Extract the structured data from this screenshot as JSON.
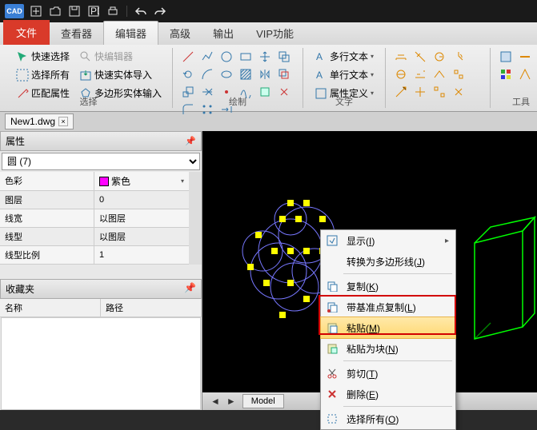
{
  "app": {
    "logo": "CAD"
  },
  "menu": {
    "file": "文件",
    "view": "查看器",
    "editor": "编辑器",
    "advanced": "高级",
    "output": "输出",
    "vip": "VIP功能"
  },
  "ribbon": {
    "select": {
      "quick_select": "快速选择",
      "quick_edit": "快编辑器",
      "select_all": "选择所有",
      "import_solid": "快速实体导入",
      "match_prop": "匹配属性",
      "polygon_input": "多边形实体输入",
      "label": "选择"
    },
    "draw": {
      "label": "绘制"
    },
    "text": {
      "mtext": "多行文本",
      "stext": "单行文本",
      "propdef": "属性定义",
      "label": "文字"
    },
    "tools": {
      "label": "工具"
    }
  },
  "doc": {
    "name": "New1.dwg"
  },
  "props": {
    "title": "属性",
    "selection": "圆 (7)",
    "rows": [
      {
        "k": "色彩",
        "v": "紫色",
        "swatch": "#ff00ff"
      },
      {
        "k": "图层",
        "v": "0"
      },
      {
        "k": "线宽",
        "v": "以图层"
      },
      {
        "k": "线型",
        "v": "以图层"
      },
      {
        "k": "线型比例",
        "v": "1"
      }
    ]
  },
  "fav": {
    "title": "收藏夹",
    "col_name": "名称",
    "col_path": "路径"
  },
  "canvas": {
    "tab_model": "Model"
  },
  "context": {
    "display": "显示",
    "display_key": "I",
    "to_polyline": "转换为多边形线",
    "to_polyline_key": "J",
    "copy": "复制",
    "copy_key": "K",
    "copy_base": "带基准点复制",
    "copy_base_key": "L",
    "paste": "粘贴",
    "paste_key": "M",
    "paste_block": "粘贴为块",
    "paste_block_key": "N",
    "cut": "剪切",
    "cut_key": "T",
    "delete": "删除",
    "delete_key": "E",
    "select_all": "选择所有",
    "select_all_key": "O"
  }
}
